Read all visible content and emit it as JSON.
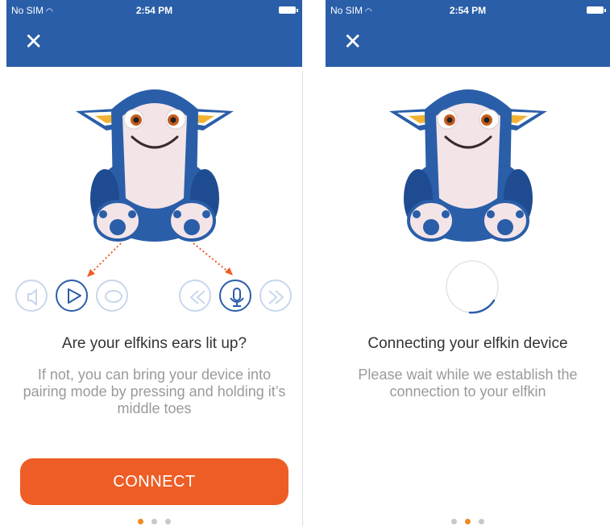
{
  "colors": {
    "header": "#2a5ea8",
    "accent": "#ee5d26",
    "dot_active": "#ee8a22"
  },
  "status_bar": {
    "carrier": "No SIM",
    "wifi_icon": "wifi-icon",
    "time": "2:54 PM"
  },
  "screen1": {
    "title": "Are your elfkins ears lit up?",
    "body": "If not, you can bring your device into pairing mode by pressing and holding it’s middle toes",
    "button_label": "CONNECT",
    "controls": [
      "volume-icon",
      "play-icon",
      "chat-icon",
      "rewind-icon",
      "microphone-icon",
      "forward-icon"
    ],
    "page_indicator": {
      "count": 3,
      "active": 1
    }
  },
  "screen2": {
    "title": "Connecting your elfkin device",
    "body": "Please wait while we establish the connection to your elfkin",
    "page_indicator": {
      "count": 3,
      "active": 2
    }
  }
}
